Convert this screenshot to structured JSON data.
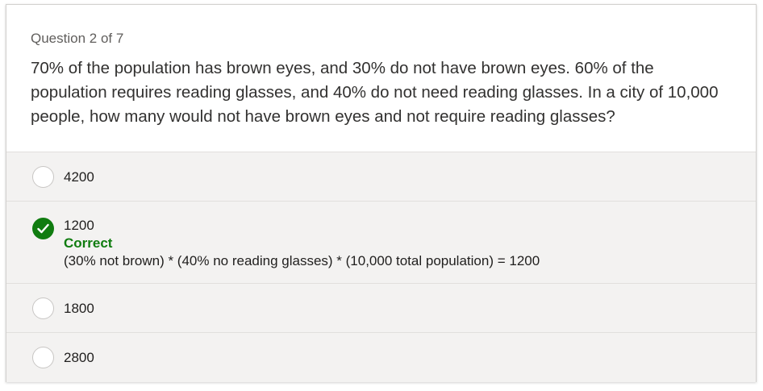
{
  "question": {
    "number_label": "Question 2 of 7",
    "text": "70% of the population has brown eyes, and 30% do not have brown eyes. 60% of the population requires reading glasses, and 40% do not need reading glasses. In a city of 10,000 people, how many would not have brown eyes and not require reading glasses?"
  },
  "options": [
    {
      "label": "4200",
      "state": "unselected"
    },
    {
      "label": "1200",
      "state": "correct",
      "feedback_title": "Correct",
      "feedback_text": "(30% not brown) * (40% no reading glasses) * (10,000 total population) = 1200"
    },
    {
      "label": "1800",
      "state": "unselected"
    },
    {
      "label": "2800",
      "state": "unselected"
    }
  ],
  "colors": {
    "correct_green": "#107c10",
    "option_background": "#f3f2f1",
    "border": "#e1dfdd"
  },
  "icons": {
    "radio": "radio-circle-icon",
    "correct": "checkmark-circle-icon"
  }
}
